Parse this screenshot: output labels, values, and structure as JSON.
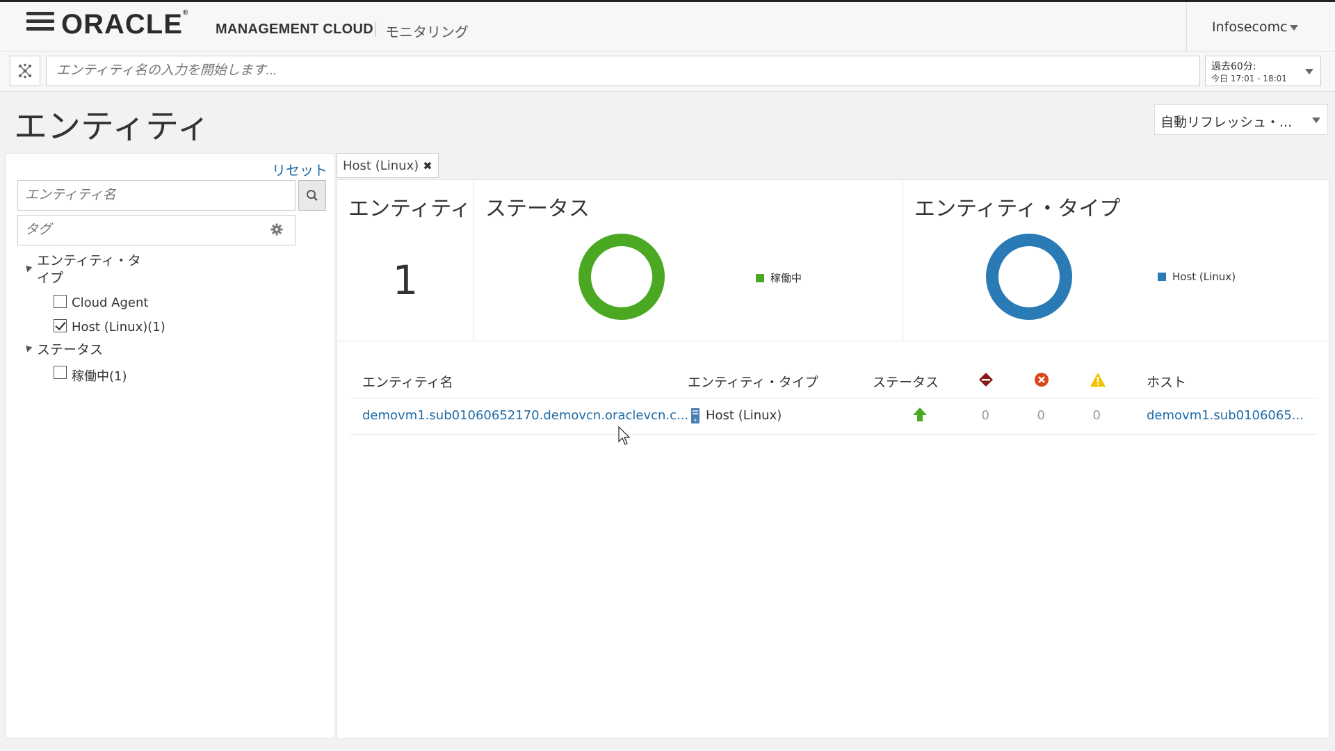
{
  "header": {
    "logo_text": "ORACLE",
    "product": "MANAGEMENT CLOUD",
    "module": "モニタリング",
    "username": "Infosecomc"
  },
  "search": {
    "placeholder": "エンティティ名の入力を開始します...",
    "time_label": "過去60分:",
    "time_range": "今日 17:01 - 18:01"
  },
  "page": {
    "title": "エンティティ",
    "refresh_label": "自動リフレッシュ・..."
  },
  "filters": {
    "reset_label": "リセット",
    "entity_name_placeholder": "エンティティ名",
    "tag_placeholder": "タグ",
    "groups": [
      {
        "heading_line1": "エンティティ・タ",
        "heading_line2": "イプ",
        "options": [
          {
            "label": "Cloud Agent",
            "checked": false
          },
          {
            "label": "Host (Linux)(1)",
            "checked": true
          }
        ]
      },
      {
        "heading_line1": "ステータス",
        "options": [
          {
            "label": "稼働中(1)",
            "checked": false
          }
        ]
      }
    ]
  },
  "chip": {
    "label": "Host (Linux)"
  },
  "summary": {
    "entity_tile": {
      "title": "エンティティ",
      "count": "1"
    },
    "status_tile": {
      "title": "ステータス",
      "legend": "稼働中",
      "color": "#4aa822"
    },
    "type_tile": {
      "title": "エンティティ・タイプ",
      "legend": "Host (Linux)",
      "color": "#2a7ab5"
    }
  },
  "chart_data": [
    {
      "type": "pie",
      "title": "ステータス",
      "categories": [
        "稼働中"
      ],
      "values": [
        1
      ],
      "colors": [
        "#4aa822"
      ],
      "style": "donut"
    },
    {
      "type": "pie",
      "title": "エンティティ・タイプ",
      "categories": [
        "Host (Linux)"
      ],
      "values": [
        1
      ],
      "colors": [
        "#2a7ab5"
      ],
      "style": "donut"
    }
  ],
  "table": {
    "columns": {
      "name": "エンティティ名",
      "type": "エンティティ・タイプ",
      "status": "ステータス",
      "host": "ホスト"
    },
    "rows": [
      {
        "name": "demovm1.sub01060652170.demovcn.oraclevcn.c...",
        "type": "Host (Linux)",
        "status": "up",
        "fatal": "0",
        "critical": "0",
        "warning": "0",
        "host": "demovm1.sub0106065..."
      }
    ]
  },
  "icons": {
    "fatal": "fatal-diamond-icon",
    "critical": "critical-x-icon",
    "warning": "warning-triangle-icon",
    "status_up": "up-arrow-icon"
  }
}
